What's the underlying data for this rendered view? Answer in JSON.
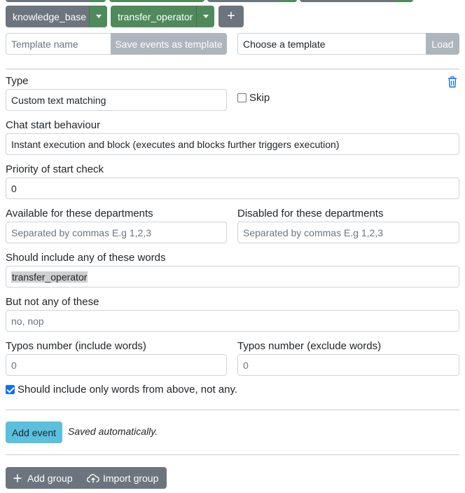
{
  "triggers": {
    "knowledge_base_label": "knowledge_base",
    "transfer_operator_label": "transfer_operator",
    "add_label": "+"
  },
  "templates": {
    "name_placeholder": "Template name",
    "save_label": "Save events as template",
    "choose_value": "Choose a template",
    "load_label": "Load"
  },
  "event": {
    "type_label": "Type",
    "type_value": "Custom text matching",
    "skip_label": "Skip",
    "chat_start_label": "Chat start behaviour",
    "chat_start_value": "Instant execution and block (executes and blocks further triggers execution)",
    "priority_label": "Priority of start check",
    "priority_value": "0",
    "available_label": "Available for these departments",
    "available_placeholder": "Separated by commas E.g 1,2,3",
    "disabled_label": "Disabled for these departments",
    "disabled_placeholder": "Separated by commas E.g 1,2,3",
    "include_label": "Should include any of these words",
    "include_value": "transfer_operator",
    "exclude_label": "But not any of these",
    "exclude_placeholder": "no, nop",
    "typos_include_label": "Typos number (include words)",
    "typos_include_placeholder": "0",
    "typos_exclude_label": "Typos number (exclude words)",
    "typos_exclude_placeholder": "0",
    "only_words_label": "Should include only words from above, not any.",
    "only_words_checked": true
  },
  "actions": {
    "add_event_label": "Add event",
    "saved_note": "Saved automatically.",
    "add_group_label": "Add group",
    "import_group_label": "Import group"
  },
  "colors": {
    "grey": "#6c757d",
    "green": "#4f8a5b",
    "info": "#5bc0de",
    "accent": "#0d6efd"
  }
}
